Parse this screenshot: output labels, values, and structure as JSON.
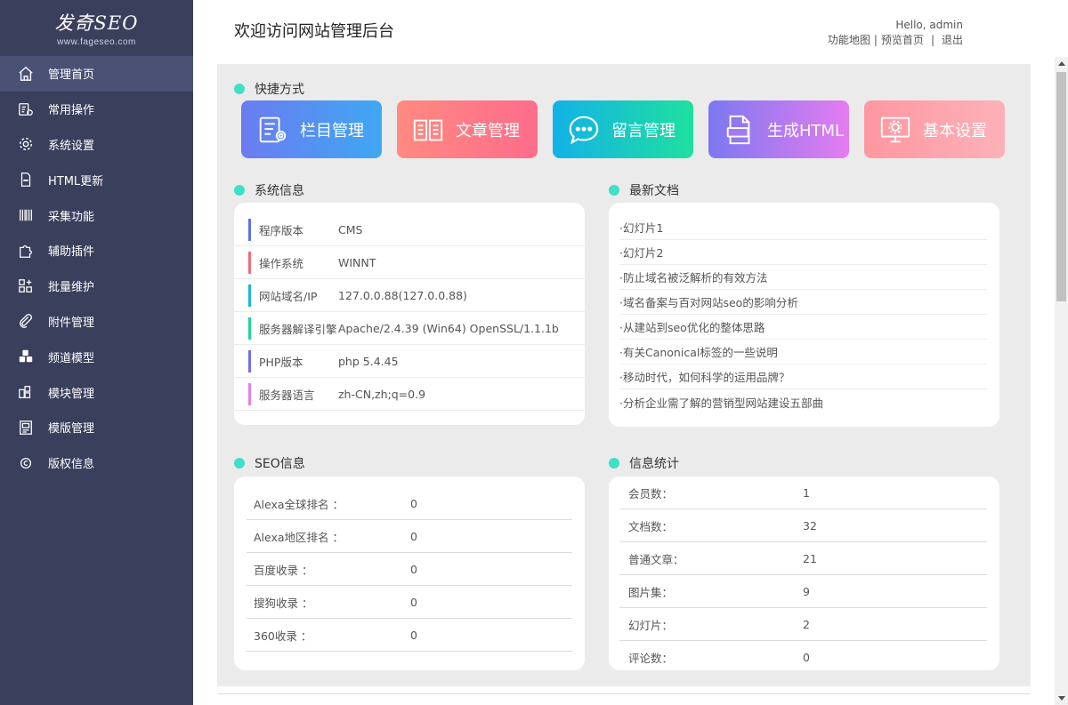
{
  "logo": {
    "main": "发奇SEO",
    "sub": "www.fageseo.com"
  },
  "sidebar": {
    "items": [
      {
        "label": "管理首页",
        "icon": "home-icon"
      },
      {
        "label": "常用操作",
        "icon": "clipboard-gear-icon"
      },
      {
        "label": "系统设置",
        "icon": "gear-icon"
      },
      {
        "label": "HTML更新",
        "icon": "html-file-icon"
      },
      {
        "label": "采集功能",
        "icon": "barcode-icon"
      },
      {
        "label": "辅助插件",
        "icon": "puzzle-icon"
      },
      {
        "label": "批量维护",
        "icon": "grid-plus-icon"
      },
      {
        "label": "附件管理",
        "icon": "paperclip-icon"
      },
      {
        "label": "频道模型",
        "icon": "cubes-icon"
      },
      {
        "label": "模块管理",
        "icon": "module-icon"
      },
      {
        "label": "模版管理",
        "icon": "template-icon"
      },
      {
        "label": "版权信息",
        "icon": "copyright-icon"
      }
    ]
  },
  "header": {
    "title": "欢迎访问网站管理后台",
    "greeting": "Hello, admin",
    "links": {
      "sitemap": "功能地图",
      "preview": "预览首页",
      "logout": "退出",
      "sep1": "|",
      "sep2": "|"
    }
  },
  "shortcuts": {
    "title": "快捷方式",
    "items": [
      {
        "label": "栏目管理",
        "icon": "column-manage-icon",
        "color_from": "#6b7cf0",
        "color_to": "#3fa7f2"
      },
      {
        "label": "文章管理",
        "icon": "book-icon",
        "color_from": "#ff8a80",
        "color_to": "#fe6c8c"
      },
      {
        "label": "留言管理",
        "icon": "chat-bubble-icon",
        "color_from": "#13b2e6",
        "color_to": "#1fe0a0"
      },
      {
        "label": "生成HTML",
        "icon": "html-doc-icon",
        "color_from": "#7c78f0",
        "color_to": "#e57cf0"
      },
      {
        "label": "基本设置",
        "icon": "monitor-gear-icon",
        "color_from": "#fe97a0",
        "color_to": "#fdb1b9"
      }
    ]
  },
  "system_info": {
    "title": "系统信息",
    "rows": [
      {
        "key": "程序版本",
        "value": "CMS",
        "color": "#5f6ff0"
      },
      {
        "key": "操作系统",
        "value": "WINNT",
        "color": "#f46a7e"
      },
      {
        "key": "网站域名/IP",
        "value": "127.0.0.88(127.0.0.88)",
        "color": "#1ab6d9"
      },
      {
        "key": "服务器解译引擎",
        "value": "Apache/2.4.39 (Win64) OpenSSL/1.1.1b",
        "color": "#21d39a"
      },
      {
        "key": "PHP版本",
        "value": "php 5.4.45",
        "color": "#6f6ff0"
      },
      {
        "key": "服务器语言",
        "value": "zh-CN,zh;q=0.9",
        "color": "#e87ee8"
      }
    ]
  },
  "latest_docs": {
    "title": "最新文档",
    "items": [
      "·幻灯片1",
      "·幻灯片2",
      "·防止域名被泛解析的有效方法",
      "·域名备案与百对网站seo的影响分析",
      "·从建站到seo优化的整体思路",
      "·有关Canonical标签的一些说明",
      "·移动时代，如何科学的运用品牌？",
      "·分析企业需了解的营销型网站建设五部曲"
    ]
  },
  "seo_info": {
    "title": "SEO信息",
    "rows": [
      {
        "key": "Alexa全球排名 ：",
        "value": "0"
      },
      {
        "key": "Alexa地区排名 ：",
        "value": "0"
      },
      {
        "key": "百度收录 ：",
        "value": "0"
      },
      {
        "key": "搜狗收录 ：",
        "value": "0"
      },
      {
        "key": "360收录 ：",
        "value": "0"
      }
    ]
  },
  "stats": {
    "title": "信息统计",
    "rows": [
      {
        "key": "会员数：",
        "value": "1"
      },
      {
        "key": "文档数：",
        "value": "32"
      },
      {
        "key": "普通文章：",
        "value": "21"
      },
      {
        "key": "图片集：",
        "value": "9"
      },
      {
        "key": "幻灯片：",
        "value": "2"
      },
      {
        "key": "评论数：",
        "value": "0"
      }
    ]
  },
  "colors": {
    "sidebar_bg": "#3a3f5c",
    "sidebar_active": "#4a5174",
    "dot": "#3ee0c8",
    "main_bg": "#ebebeb"
  }
}
